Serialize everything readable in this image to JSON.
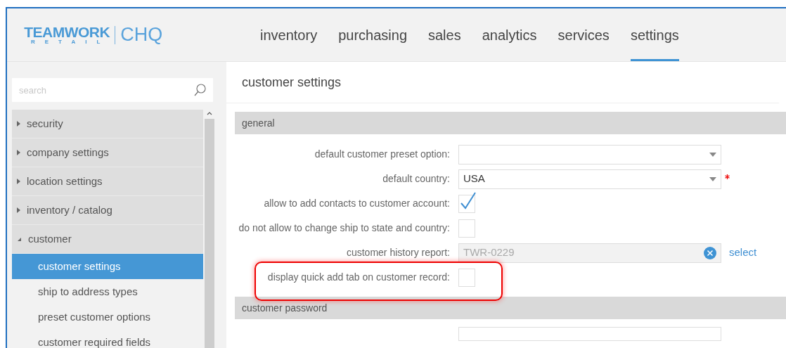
{
  "logo": {
    "brand": "TEAMWORK",
    "sub": "RETAIL",
    "product": "CHQ"
  },
  "nav": [
    {
      "label": "inventory",
      "selected": false
    },
    {
      "label": "purchasing",
      "selected": false
    },
    {
      "label": "sales",
      "selected": false
    },
    {
      "label": "analytics",
      "selected": false
    },
    {
      "label": "services",
      "selected": false
    },
    {
      "label": "settings",
      "selected": true
    }
  ],
  "sidebar": {
    "search": {
      "placeholder": "search"
    },
    "items": [
      {
        "label": "security",
        "expanded": false
      },
      {
        "label": "company settings",
        "expanded": false
      },
      {
        "label": "location settings",
        "expanded": false
      },
      {
        "label": "inventory / catalog",
        "expanded": false
      },
      {
        "label": "customer",
        "expanded": true,
        "children": [
          {
            "label": "customer settings",
            "selected": true
          },
          {
            "label": "ship to address types",
            "selected": false
          },
          {
            "label": "preset customer options",
            "selected": false
          },
          {
            "label": "customer required fields",
            "selected": false
          }
        ]
      }
    ]
  },
  "page_title": "customer settings",
  "sections": [
    {
      "title": "general",
      "fields": [
        {
          "kind": "select",
          "label": "default customer preset option:",
          "required": false
        },
        {
          "kind": "select",
          "label": "default country:",
          "value": "USA",
          "required": true
        },
        {
          "kind": "checkbox",
          "label": "allow to add contacts to customer account:",
          "checked": true
        },
        {
          "kind": "checkbox",
          "label": "do not allow to change ship to state and country:",
          "checked": false
        },
        {
          "kind": "lookup",
          "label": "customer history report:",
          "value": "TWR-0229",
          "action": "select"
        },
        {
          "kind": "checkbox",
          "label": "display quick add tab on customer record:",
          "checked": false,
          "highlighted": true
        }
      ]
    },
    {
      "title": "customer password",
      "fields": [
        {
          "kind": "partial"
        }
      ]
    }
  ]
}
